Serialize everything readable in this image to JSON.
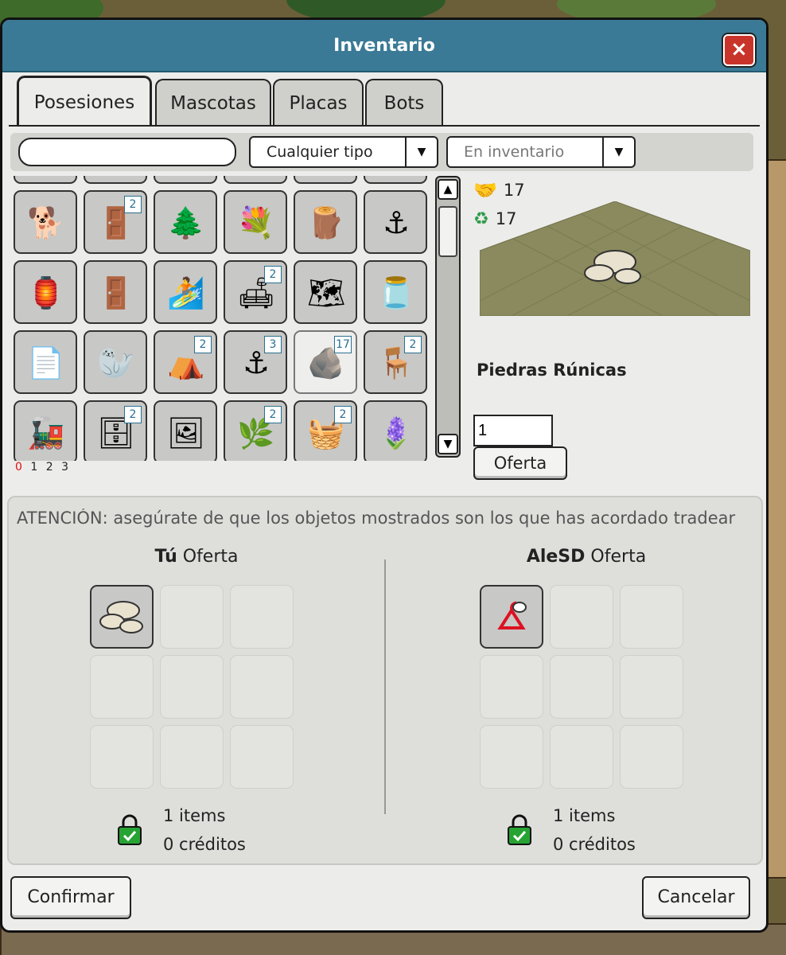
{
  "window": {
    "title": "Inventario",
    "close_icon": "×"
  },
  "tabs": [
    {
      "label": "Posesiones",
      "active": true
    },
    {
      "label": "Mascotas",
      "active": false
    },
    {
      "label": "Placas",
      "active": false
    },
    {
      "label": "Bots",
      "active": false
    }
  ],
  "filters": {
    "search_value": "",
    "type_select": "Cualquier tipo",
    "location_select": "En inventario"
  },
  "inventory": {
    "items": [
      {
        "icon": "dog-plush-icon",
        "glyph": "🐕",
        "count": ""
      },
      {
        "icon": "wooden-wardrobe-icon",
        "glyph": "🚪",
        "count": "2"
      },
      {
        "icon": "pine-trees-icon",
        "glyph": "🌲",
        "count": ""
      },
      {
        "icon": "flower-arch-icon",
        "glyph": "💐",
        "count": ""
      },
      {
        "icon": "fence-bench-icon",
        "glyph": "🪵",
        "count": ""
      },
      {
        "icon": "anchor-chain-icon",
        "glyph": "⚓",
        "count": ""
      },
      {
        "icon": "lantern-cart-icon",
        "glyph": "🏮",
        "count": ""
      },
      {
        "icon": "door-icon",
        "glyph": "🚪",
        "count": ""
      },
      {
        "icon": "surfboard-icon",
        "glyph": "🏄",
        "count": ""
      },
      {
        "icon": "green-sofa-icon",
        "glyph": "🛋",
        "count": "2"
      },
      {
        "icon": "map-table-icon",
        "glyph": "🗺",
        "count": ""
      },
      {
        "icon": "glass-jar-icon",
        "glyph": "🫙",
        "count": ""
      },
      {
        "icon": "paper-note-icon",
        "glyph": "📄",
        "count": ""
      },
      {
        "icon": "seal-statue-icon",
        "glyph": "🦭",
        "count": ""
      },
      {
        "icon": "blue-tent-icon",
        "glyph": "⛺",
        "count": "2"
      },
      {
        "icon": "anchor-icon",
        "glyph": "⚓",
        "count": "3"
      },
      {
        "icon": "rune-stones-icon",
        "glyph": "🪨",
        "count": "17",
        "selected": true
      },
      {
        "icon": "office-chair-icon",
        "glyph": "🪑",
        "count": "2"
      },
      {
        "icon": "toy-train-icon",
        "glyph": "🚂",
        "count": ""
      },
      {
        "icon": "reception-desk-icon",
        "glyph": "🗄",
        "count": "2"
      },
      {
        "icon": "framed-picture-icon",
        "glyph": "🖼",
        "count": ""
      },
      {
        "icon": "plant-icon",
        "glyph": "🌿",
        "count": "2"
      },
      {
        "icon": "green-basket-icon",
        "glyph": "🧺",
        "count": "2"
      },
      {
        "icon": "lavender-flower-icon",
        "glyph": "🪻",
        "count": ""
      }
    ],
    "pages": [
      "0",
      "1",
      "2",
      "3"
    ],
    "current_page": "0"
  },
  "detail": {
    "handshake_count": "17",
    "recycle_count": "17",
    "item_name": "Piedras Rúnicas",
    "quantity": "1",
    "offer_button": "Oferta"
  },
  "trade": {
    "notice": "ATENCIÓN: asegúrate de que los objetos mostrados son los que has acordado tradear",
    "you": {
      "name": "Tú",
      "label": "Oferta",
      "items_text": "1 items",
      "credits_text": "0 créditos",
      "slot_icon": "rune-stones-icon"
    },
    "other": {
      "name": "AleSD",
      "label": "Oferta",
      "items_text": "1 items",
      "credits_text": "0 créditos",
      "slot_icon": "red-hanger-icon"
    }
  },
  "buttons": {
    "confirm": "Confirmar",
    "cancel": "Cancelar"
  },
  "colors": {
    "titlebar": "#3a7a96",
    "close": "#c9342a",
    "lock_green": "#27a333"
  }
}
